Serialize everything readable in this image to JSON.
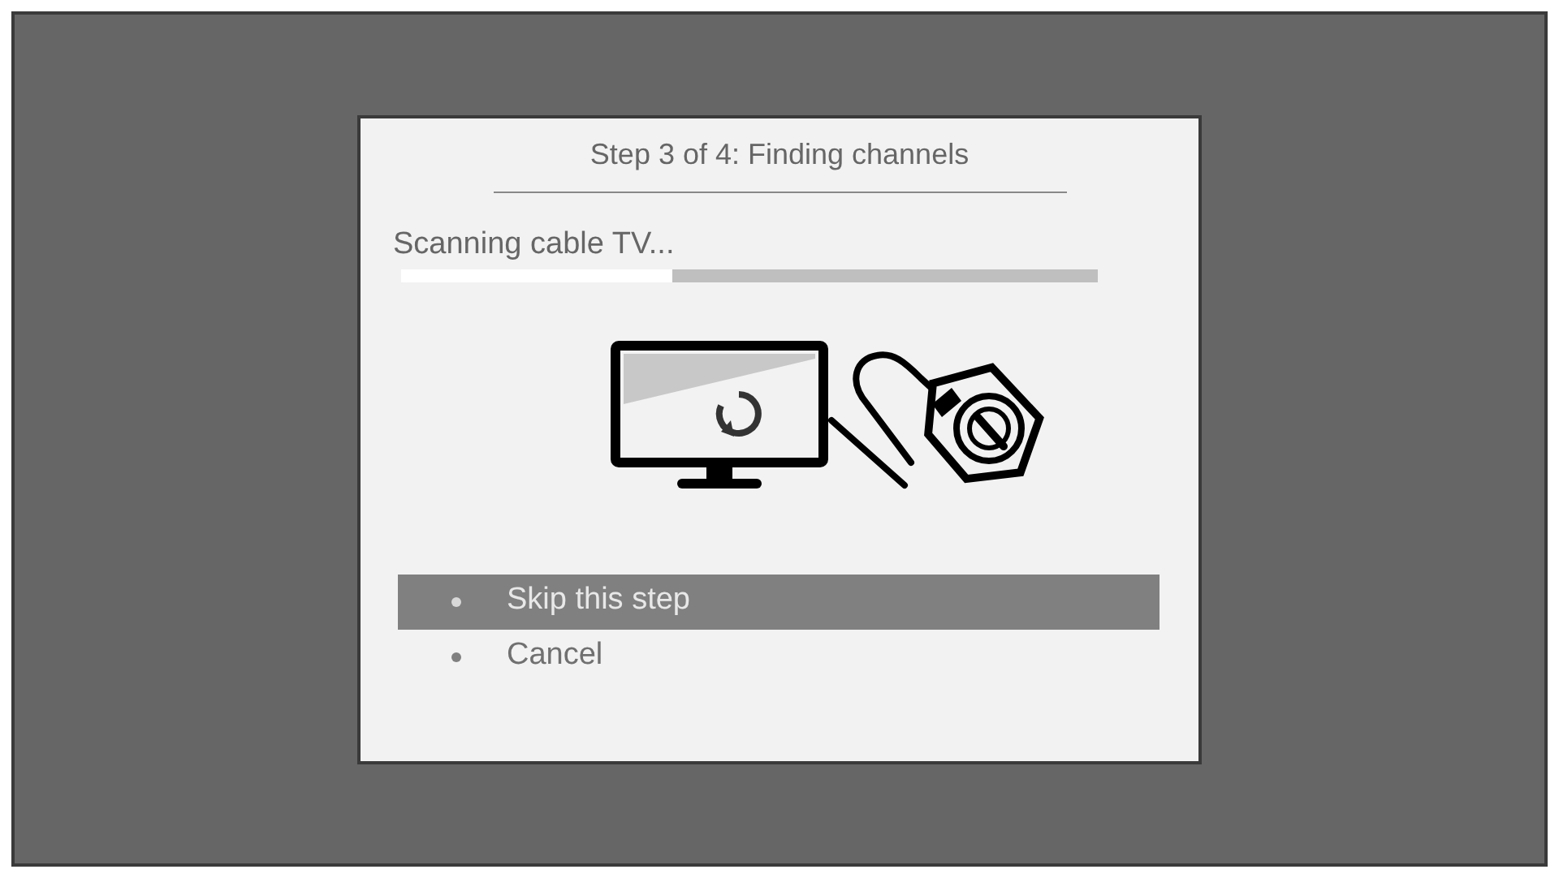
{
  "dialog": {
    "title": "Step 3 of 4: Finding channels",
    "status": "Scanning cable TV...",
    "progress": {
      "level": 0.39
    },
    "options": [
      {
        "label": "Skip this step",
        "selected": true
      },
      {
        "label": "Cancel",
        "selected": false
      }
    ]
  }
}
